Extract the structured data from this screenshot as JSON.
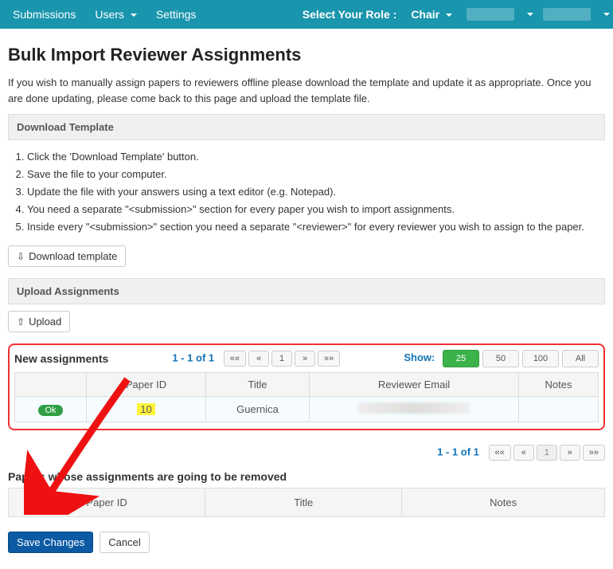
{
  "navbar": {
    "items": [
      {
        "label": "Submissions",
        "has_caret": false
      },
      {
        "label": "Users",
        "has_caret": true
      },
      {
        "label": "Settings",
        "has_caret": false
      }
    ],
    "role_label": "Select Your Role :",
    "role_value": "Chair"
  },
  "page": {
    "title": "Bulk Import Reviewer Assignments",
    "intro": "If you wish to manually assign papers to reviewers offline please download the template and update it as appropriate. Once you are done updating, please come back to this page and upload the template file."
  },
  "download_panel": {
    "heading": "Download Template",
    "steps": [
      "Click the 'Download Template' button.",
      "Save the file to your computer.",
      "Update the file with your answers using a text editor (e.g. Notepad).",
      "You need a separate \"<submission>\" section for every paper you wish to import assignments.",
      "Inside every \"<submission>\" section you need a separate \"<reviewer>\" for every reviewer you wish to assign to the paper."
    ],
    "button": "Download template"
  },
  "upload_panel": {
    "heading": "Upload Assignments",
    "button": "Upload"
  },
  "new_assignments": {
    "heading": "New assignments",
    "page_info": "1 - 1 of 1",
    "pager": {
      "first": "««",
      "prev": "«",
      "page": "1",
      "next": "»",
      "last": "»»"
    },
    "show_label": "Show:",
    "show_options": [
      "25",
      "50",
      "100",
      "All"
    ],
    "show_active": "25",
    "columns": [
      "",
      "Paper ID",
      "Title",
      "Reviewer Email",
      "Notes"
    ],
    "rows": [
      {
        "status": "Ok",
        "paper_id": "10",
        "title": "Guernica",
        "email": "",
        "notes": ""
      }
    ]
  },
  "bottom_pager": {
    "page_info": "1 - 1 of 1",
    "pager": {
      "first": "««",
      "prev": "«",
      "page": "1",
      "next": "»",
      "last": "»»"
    }
  },
  "remove_section": {
    "heading": "Papers whose assignments are going to be removed",
    "columns": [
      "Paper ID",
      "Title",
      "Notes"
    ]
  },
  "actions": {
    "save": "Save Changes",
    "cancel": "Cancel"
  }
}
